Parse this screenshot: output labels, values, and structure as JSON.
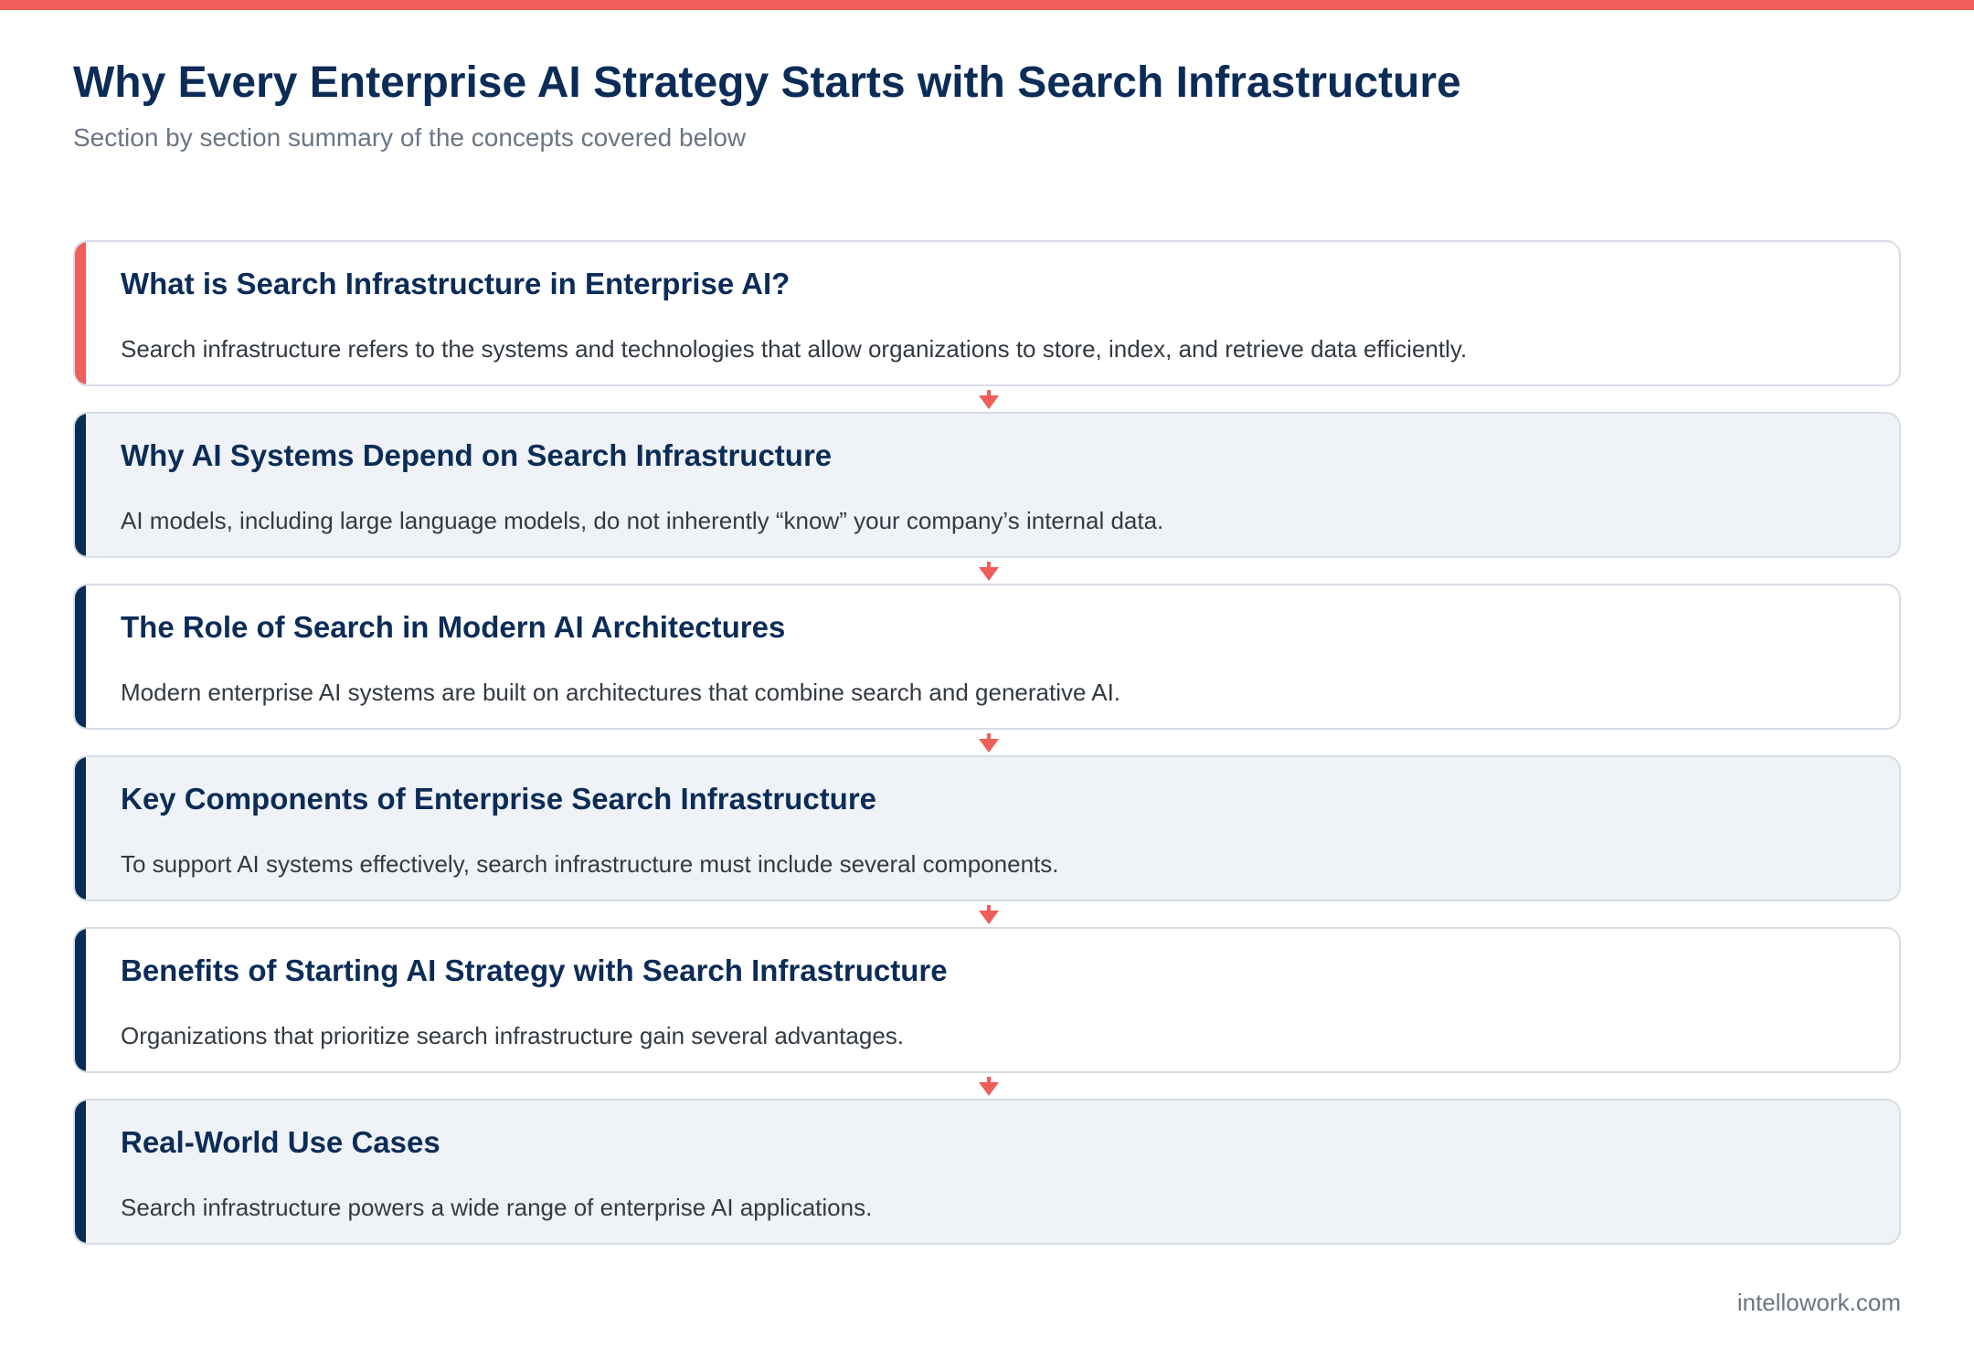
{
  "header": {
    "title": "Why Every Enterprise AI Strategy Starts with Search Infrastructure",
    "subtitle": "Section by section summary of the concepts covered below"
  },
  "sections": [
    {
      "title": "What is Search Infrastructure in Enterprise AI?",
      "description": "Search infrastructure refers to the systems and technologies that allow organizations to store, index, and retrieve data efficiently."
    },
    {
      "title": "Why AI Systems Depend on Search Infrastructure",
      "description": "AI models, including large language models, do not inherently “know” your company’s internal data."
    },
    {
      "title": "The Role of Search in Modern AI Architectures",
      "description": "Modern enterprise AI systems are built on architectures that combine search and generative AI."
    },
    {
      "title": "Key Components of Enterprise Search Infrastructure",
      "description": "To support AI systems effectively, search infrastructure must include several components."
    },
    {
      "title": "Benefits of Starting AI Strategy with Search Infrastructure",
      "description": "Organizations that prioritize search infrastructure gain several advantages."
    },
    {
      "title": "Real-World Use Cases",
      "description": "Search infrastructure powers a wide range of enterprise AI applications."
    }
  ],
  "footer": {
    "site": "intellowork.com"
  },
  "colors": {
    "accent_red": "#ef5e58",
    "navy": "#0c2c58",
    "card_alt_bg": "#eff3f7",
    "border": "#d5dde6"
  },
  "icons": {
    "connector": "arrow-down-icon"
  }
}
